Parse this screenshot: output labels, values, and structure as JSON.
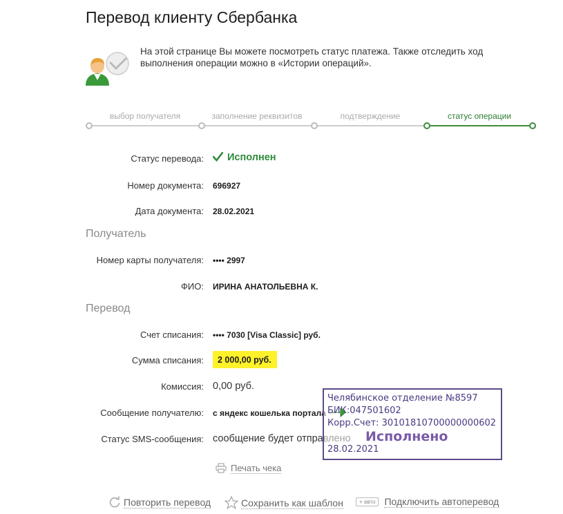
{
  "page": {
    "title": "Перевод клиенту Сбербанка"
  },
  "intro": {
    "text": "На этой странице Вы можете посмотреть статус платежа. Также отследить ход выполнения операции можно в «Истории операций»."
  },
  "stepper": {
    "steps": [
      {
        "label": "выбор получателя",
        "active": false
      },
      {
        "label": "заполнение реквизитов",
        "active": false
      },
      {
        "label": "подтверждение",
        "active": false
      },
      {
        "label": "статус операции",
        "active": true
      }
    ]
  },
  "details": {
    "status_label": "Статус перевода:",
    "status_value": "Исполнен",
    "doc_number_label": "Номер документа:",
    "doc_number_value": "696927",
    "doc_date_label": "Дата документа:",
    "doc_date_value": "28.02.2021"
  },
  "recipient": {
    "section_title": "Получатель",
    "card_label": "Номер карты получателя:",
    "card_value": "•••• 2997",
    "name_label": "ФИО:",
    "name_value": "ИРИНА АНАТОЛЬЕВНА К."
  },
  "transfer": {
    "section_title": "Перевод",
    "account_label": "Счет списания:",
    "account_value": "•••• 7030  [Visa Classic]  руб.",
    "amount_label": "Сумма списания:",
    "amount_value": "2 000,00  руб.",
    "fee_label": "Комиссия:",
    "fee_value": "0,00 руб.",
    "message_label": "Сообщение получателю:",
    "message_value": "с яндекс кошелька портала",
    "sms_label": "Статус SMS-сообщения:",
    "sms_value": "сообщение будет отправлено"
  },
  "stamp": {
    "branch": "Челябинское отделение №8597",
    "bik": "БИК:047501602",
    "corr": "Корр.Счет: 30101810700000000602",
    "status": "Исполнено",
    "date": "28.02.2021"
  },
  "actions": {
    "print_label": "Печать чека",
    "repeat_label": "Повторить перевод",
    "template_label": "Сохранить как шаблон",
    "auto_badge": "+ авто",
    "autopay_label": "Подключить автоперевод"
  },
  "colors": {
    "accent_green": "#2e8b3a",
    "amount_highlight": "#fff12a",
    "stamp_border": "#5e4a8a"
  }
}
